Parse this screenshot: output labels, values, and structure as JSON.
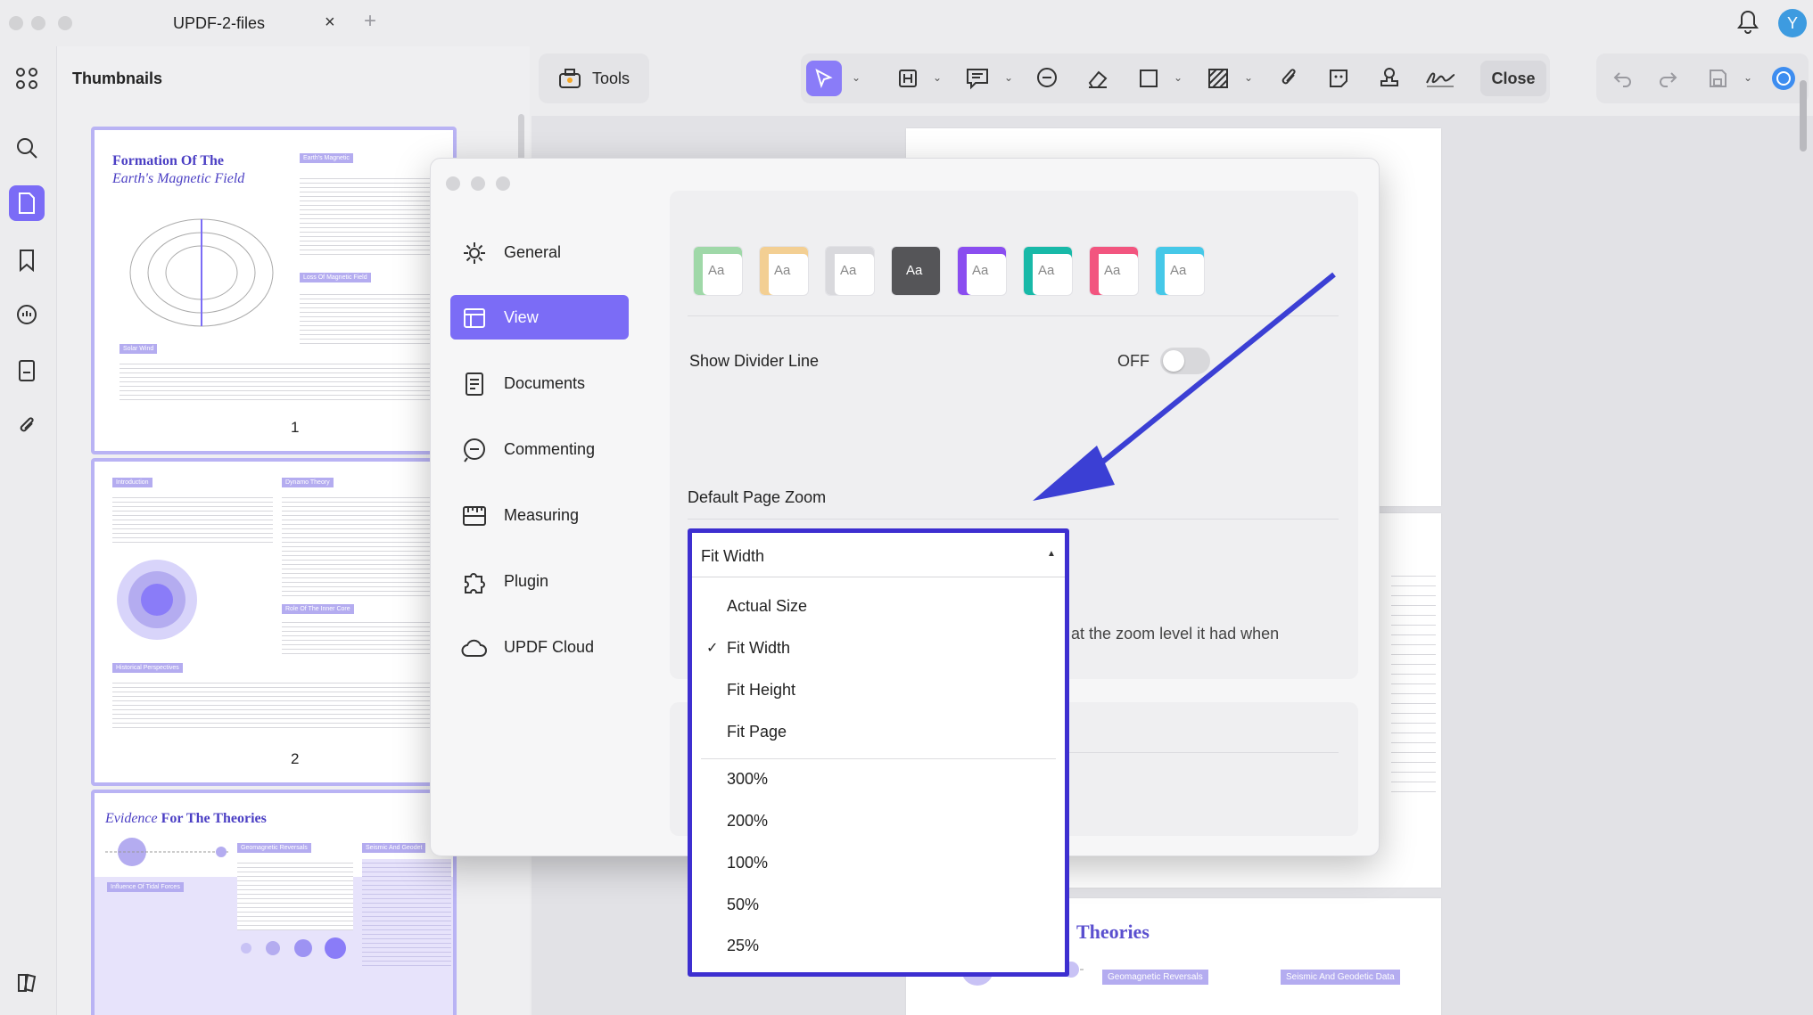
{
  "window": {
    "tab_title": "UPDF-2-files",
    "tab_close": "×",
    "tab_add": "+",
    "avatar_initial": "Y"
  },
  "thumbnails": {
    "title": "Thumbnails",
    "pages": [
      {
        "number": "1",
        "heading": "Formation Of The",
        "heading2": "Earth's Magnetic Field",
        "tag1": "Earth's Magnetic",
        "tag2": "Loss Of Magnetic Field",
        "tag3": "Solar Wind"
      },
      {
        "number": "2",
        "tag1": "Introduction",
        "tag2": "Dynamo Theory",
        "tag3": "Role Of The Inner Core",
        "tag4": "Historical Perspectives"
      },
      {
        "number": "",
        "heading": "Evidence",
        "heading2": "For The Theories",
        "tag1": "Geomagnetic Reversals",
        "tag2": "Seismic And Geodet",
        "tag3": "Influence Of Tidal Forces"
      }
    ]
  },
  "toolbar": {
    "tools_label": "Tools",
    "close_label": "Close"
  },
  "document": {
    "partial_line": "pen at the zoom level it had when",
    "theories_heading": "Theories",
    "tag_reversals": "Geomagnetic Reversals",
    "tag_seismic": "Seismic And Geodetic Data"
  },
  "preferences": {
    "nav": [
      {
        "label": "General",
        "icon": "gear-icon"
      },
      {
        "label": "View",
        "icon": "view-layout-icon"
      },
      {
        "label": "Documents",
        "icon": "document-icon"
      },
      {
        "label": "Commenting",
        "icon": "comment-icon"
      },
      {
        "label": "Measuring",
        "icon": "ruler-icon"
      },
      {
        "label": "Plugin",
        "icon": "puzzle-icon"
      },
      {
        "label": "UPDF Cloud",
        "icon": "cloud-icon"
      }
    ],
    "active_nav": "View",
    "theme_colors": [
      "#9fd8a8",
      "#f3cf93",
      "#d9d9dd",
      "#555558",
      "#8a4df0",
      "#18b9a8",
      "#f2557f",
      "#45c8e8"
    ],
    "theme_glyph": "Aa",
    "show_divider_label": "Show Divider Line",
    "show_divider_state": "OFF",
    "default_zoom_label": "Default Page Zoom",
    "zoom": {
      "selected": "Fit Width",
      "options_group1": [
        "Actual Size",
        "Fit Width",
        "Fit Height",
        "Fit Page"
      ],
      "options_group2": [
        "300%",
        "200%",
        "100%",
        "50%",
        "25%"
      ],
      "check_mark": "✓"
    }
  },
  "colors": {
    "accent": "#7b6cf6",
    "dropdown_border": "#3d2fd0",
    "arrow": "#3b3fd4"
  }
}
